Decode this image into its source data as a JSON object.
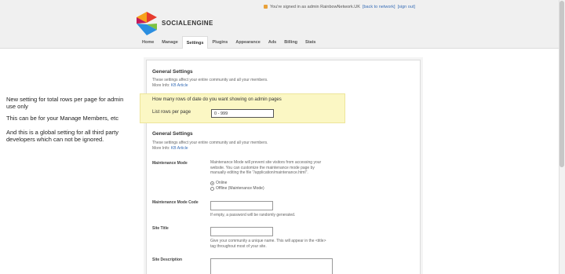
{
  "header": {
    "brand": "SOCIALENGINE",
    "signed_in_text": "You're signed in as admin RainbowNetwork.UK",
    "back_to_network": "[back to network]",
    "sign_out": "[sign out]"
  },
  "nav": {
    "tabs": [
      {
        "label": "Home"
      },
      {
        "label": "Manage"
      },
      {
        "label": "Settings"
      },
      {
        "label": "Plugins"
      },
      {
        "label": "Appearance"
      },
      {
        "label": "Ads"
      },
      {
        "label": "Billing"
      },
      {
        "label": "Stats"
      }
    ],
    "active": "Settings"
  },
  "annotations": {
    "line1": "New setting for total rows per page for admin use only",
    "line2": "This can be for your Manage Members, etc",
    "line3": "And this is a global setting for all third party developers which can not be ignored."
  },
  "top_section": {
    "title": "General Settings",
    "desc": "These settings affect your entire community and all your members.",
    "more_info_prefix": "More Info:",
    "more_info_link": "KB Article"
  },
  "highlight_box": {
    "question": "How many rows of date do you want showing on admin pages",
    "label": "List rows per page",
    "value": "0 - 999"
  },
  "general": {
    "title": "General Settings",
    "desc": "These settings affect your entire community and all your members.",
    "more_info_prefix": "More Info:",
    "more_info_link": "KB Article",
    "maintenance_label": "Maintenance Mode",
    "maintenance_help": "Maintenance Mode will prevent site visitors from accessing your website. You can customize the maintenance mode page by manually editing the file \"/application/maintenance.html\".",
    "option_online": "Online",
    "option_offline": "Offline (Maintenance Mode)",
    "maint_code_label": "Maintenance Mode Code",
    "maint_code_help": "If empty, a password will be randomly generated.",
    "site_title_label": "Site Title",
    "site_title_help": "Give your community a unique name. This will appear in the <title> tag throughout most of your site.",
    "site_desc_label": "Site Description"
  },
  "colors": {
    "header_bg": "#f0f0f0",
    "highlight_bg": "#fbf7c4",
    "link": "#3a6fb7"
  }
}
